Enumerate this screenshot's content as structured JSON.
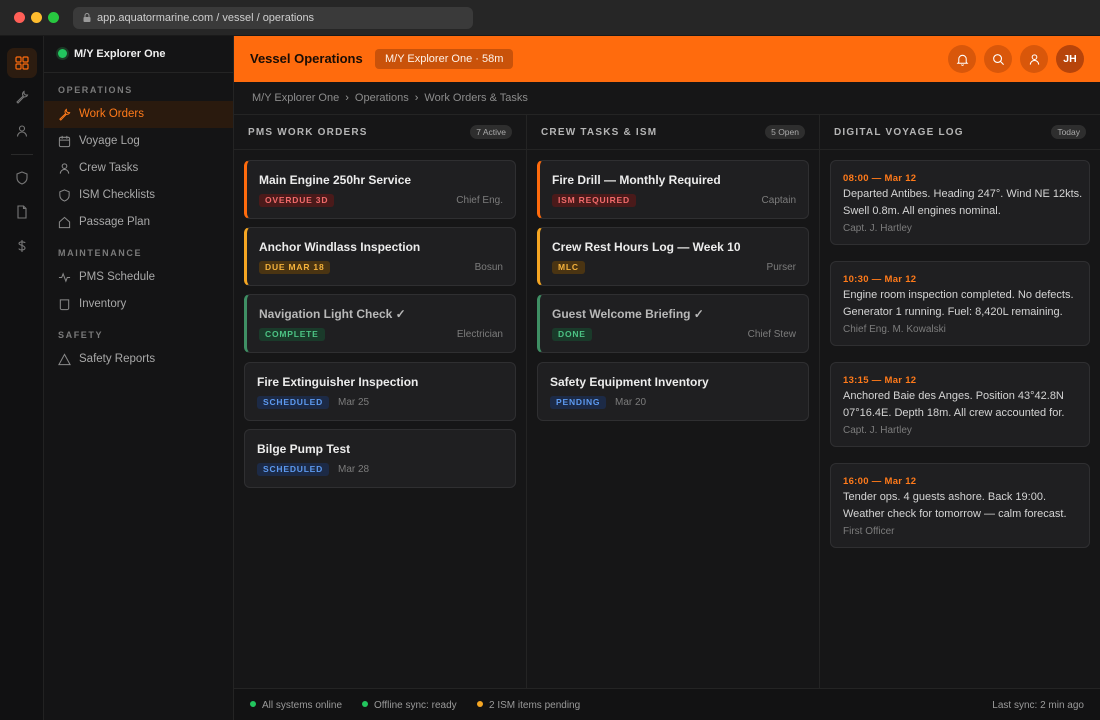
{
  "browser": {
    "url": "app.aquatormarine.com / vessel / operations"
  },
  "sidebar": {
    "vessel_name": "M/Y Explorer One",
    "sections": [
      {
        "label": "OPERATIONS",
        "items": [
          "Work Orders",
          "Voyage Log",
          "Crew Tasks",
          "ISM Checklists",
          "Passage Plan"
        ]
      },
      {
        "label": "MAINTENANCE",
        "items": [
          "PMS Schedule",
          "Inventory"
        ]
      },
      {
        "label": "SAFETY",
        "items": [
          "Safety Reports"
        ]
      }
    ]
  },
  "header": {
    "title": "Vessel Operations",
    "vessel_pill": "M/Y Explorer One · 58m",
    "avatar_initials": "JH"
  },
  "breadcrumb": [
    "M/Y Explorer One",
    "Operations",
    "Work Orders & Tasks"
  ],
  "columns": {
    "work_orders": {
      "title": "PMS WORK ORDERS",
      "badge": "7 Active",
      "cards": [
        {
          "title": "Main Engine 250hr Service",
          "tag": "OVERDUE 3D",
          "meta": "Chief Eng."
        },
        {
          "title": "Anchor Windlass Inspection",
          "tag": "DUE MAR 18",
          "meta": "Bosun"
        },
        {
          "title": "Navigation Light Check ✓",
          "tag": "COMPLETE",
          "meta": "Electrician"
        },
        {
          "title": "Fire Extinguisher Inspection",
          "tag": "SCHEDULED",
          "date": "Mar 25"
        },
        {
          "title": "Bilge Pump Test",
          "tag": "SCHEDULED",
          "date": "Mar 28"
        }
      ]
    },
    "crew_tasks": {
      "title": "CREW TASKS & ISM",
      "badge": "5 Open",
      "cards": [
        {
          "title": "Fire Drill — Monthly Required",
          "tag": "ISM REQUIRED",
          "meta": "Captain"
        },
        {
          "title": "Crew Rest Hours Log — Week 10",
          "tag": "MLC",
          "meta": "Purser"
        },
        {
          "title": "Guest Welcome Briefing ✓",
          "tag": "DONE",
          "meta": "Chief Stew"
        },
        {
          "title": "Safety Equipment Inventory",
          "tag": "PENDING",
          "date": "Mar 20"
        }
      ]
    },
    "voyage_log": {
      "title": "DIGITAL VOYAGE LOG",
      "badge": "Today",
      "entries": [
        {
          "time": "08:00 — Mar 12",
          "text": "Departed Antibes. Heading 247°. Wind NE 12kts. Swell 0.8m. All engines nominal.",
          "author": "Capt. J. Hartley"
        },
        {
          "time": "10:30 — Mar 12",
          "text": "Engine room inspection completed. No defects. Generator 1 running. Fuel: 8,420L remaining.",
          "author": "Chief Eng. M. Kowalski"
        },
        {
          "time": "13:15 — Mar 12",
          "text": "Anchored Baie des Anges. Position 43°42.8N 07°16.4E. Depth 18m. All crew accounted for.",
          "author": "Capt. J. Hartley"
        },
        {
          "time": "16:00 — Mar 12",
          "text": "Tender ops. 4 guests ashore. Back 19:00. Weather check for tomorrow — calm forecast.",
          "author": "First Officer"
        }
      ]
    }
  },
  "footer": {
    "status": [
      "All systems online",
      "Offline sync: ready",
      "2 ISM items pending"
    ],
    "last_sync": "Last sync: 2 min ago"
  },
  "colors": {
    "accent": "#ff6b0d",
    "online": "#22c55e",
    "warning": "#f5a623"
  }
}
